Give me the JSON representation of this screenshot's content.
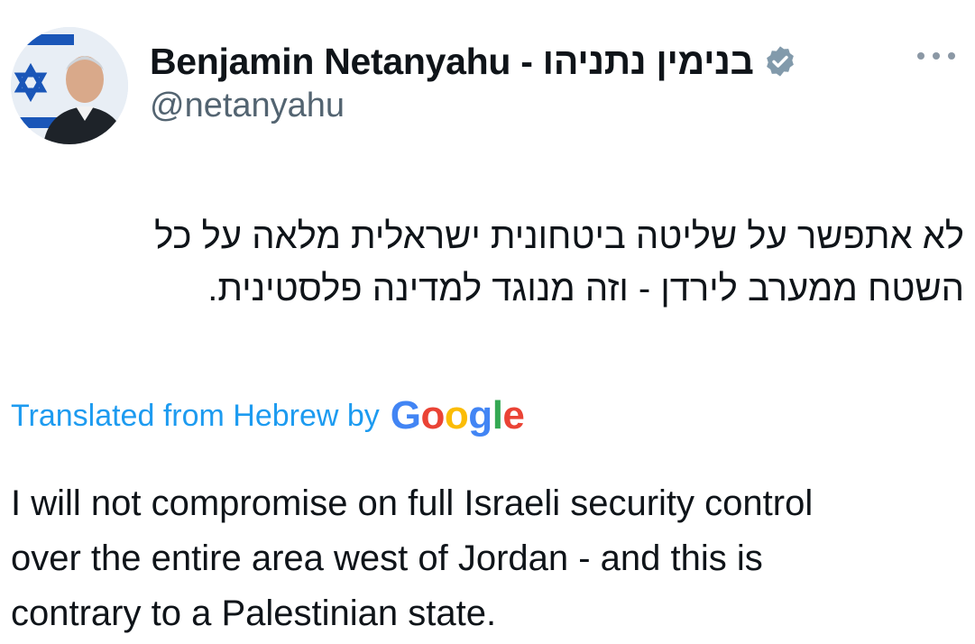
{
  "author": {
    "display_name": "Benjamin Netanyahu - בנימין נתניהו",
    "handle": "@netanyahu",
    "verified": true,
    "avatar_icon": "profile-photo-with-israeli-flag"
  },
  "post": {
    "original_lines": [
      "לא אתפשר על שליטה ביטחונית ישראלית מלאה על כל",
      "השטח ממערב לירדן - וזה מנוגד למדינה פלסטינית."
    ],
    "translated_label": "Translated from Hebrew by",
    "translation_provider": "Google",
    "translation_lines": [
      "I will not compromise on full Israeli security control",
      "over the entire area west of Jordan - and this is",
      "contrary to a Palestinian state."
    ]
  },
  "colors": {
    "link_blue": "#1d9bf0",
    "secondary_text": "#536471",
    "verified_badge": "#829aab"
  }
}
